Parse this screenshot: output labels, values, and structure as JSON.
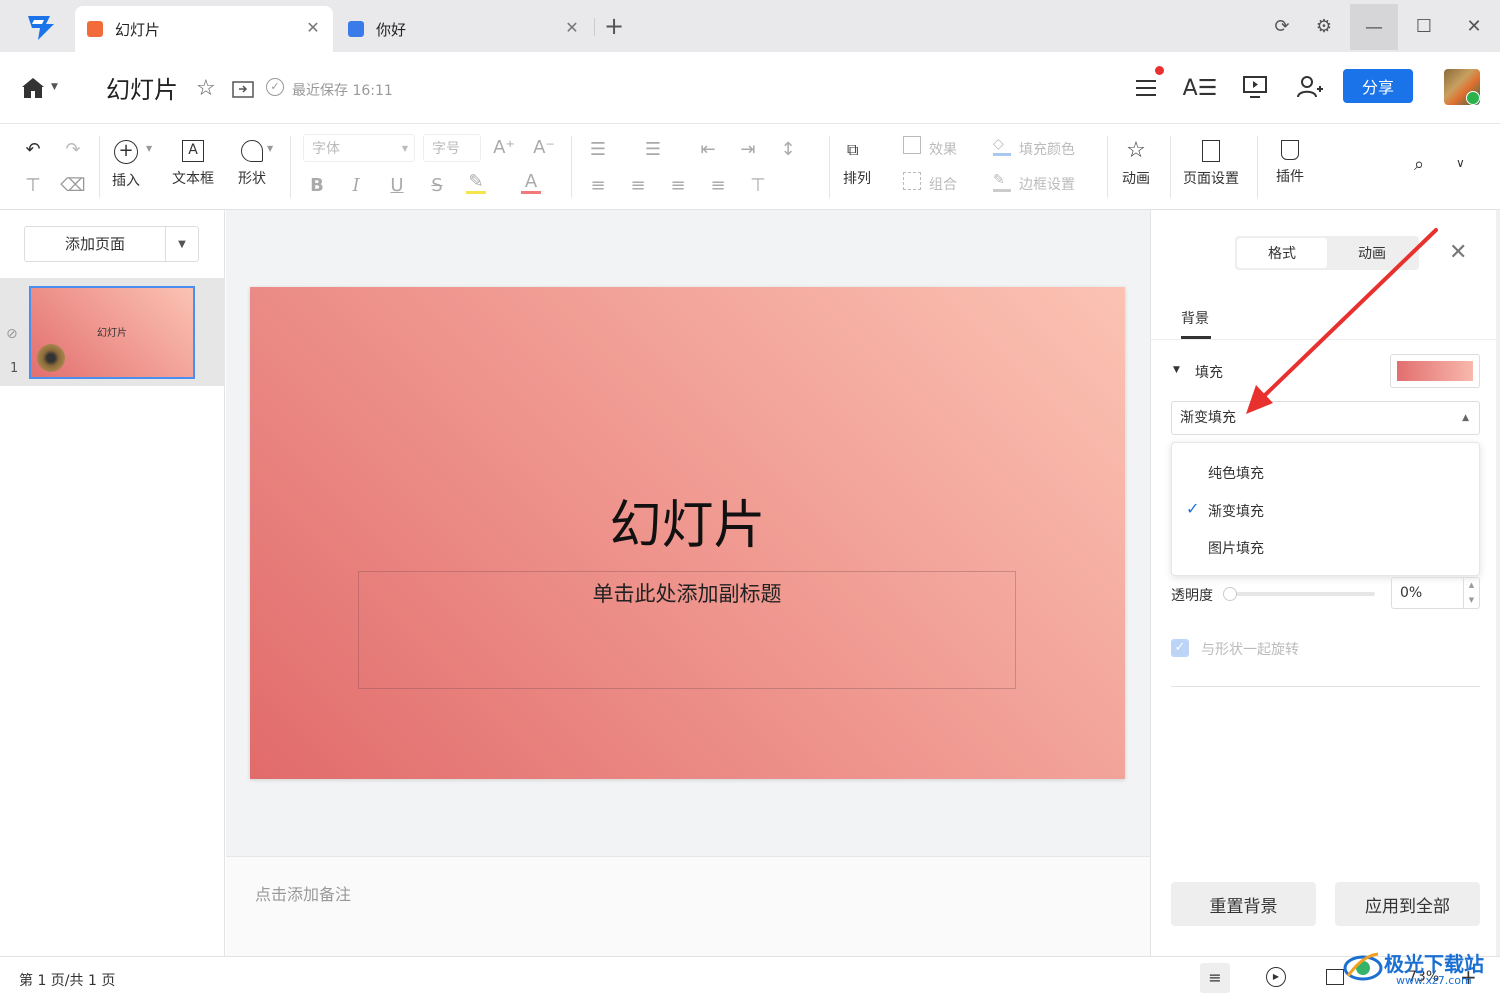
{
  "tabs": [
    {
      "label": "幻灯片",
      "color": "#f26b3a",
      "active": true
    },
    {
      "label": "你好",
      "color": "#3a7bea",
      "active": false
    }
  ],
  "header": {
    "doc_title": "幻灯片",
    "save_status": "最近保存 16:11",
    "share_label": "分享"
  },
  "toolbar": {
    "insert": "插入",
    "textbox": "文本框",
    "shape": "形状",
    "font": "字体",
    "font_size": "字号",
    "arrange": "排列",
    "effect": "效果",
    "group": "组合",
    "fill_color": "填充颜色",
    "border_settings": "边框设置",
    "animation": "动画",
    "page_setup": "页面设置",
    "plugin": "插件"
  },
  "left_pane": {
    "add_page": "添加页面",
    "thumb_title": "幻灯片",
    "thumb_number": "1"
  },
  "slide": {
    "title": "幻灯片",
    "subtitle": "单击此处添加副标题"
  },
  "notes_placeholder": "点击添加备注",
  "right_panel": {
    "tab_format": "格式",
    "tab_animation": "动画",
    "section_tab": "背景",
    "fill_label": "填充",
    "fill_selected": "渐变填充",
    "fill_options": [
      "纯色填充",
      "渐变填充",
      "图片填充"
    ],
    "opacity_label": "透明度",
    "opacity_value": "0%",
    "rotate_with_shape": "与形状一起旋转",
    "reset_bg": "重置背景",
    "apply_all": "应用到全部"
  },
  "status": {
    "page_info": "第 1 页/共 1 页",
    "zoom": "73%"
  },
  "watermark": {
    "text": "极光下载站",
    "url": "www.xz7.com"
  },
  "colors": {
    "accent": "#1a73e8",
    "slide_gradient_start": "#e16b6b",
    "slide_gradient_end": "#fbc3b3",
    "annotation_arrow": "#e8312f"
  }
}
